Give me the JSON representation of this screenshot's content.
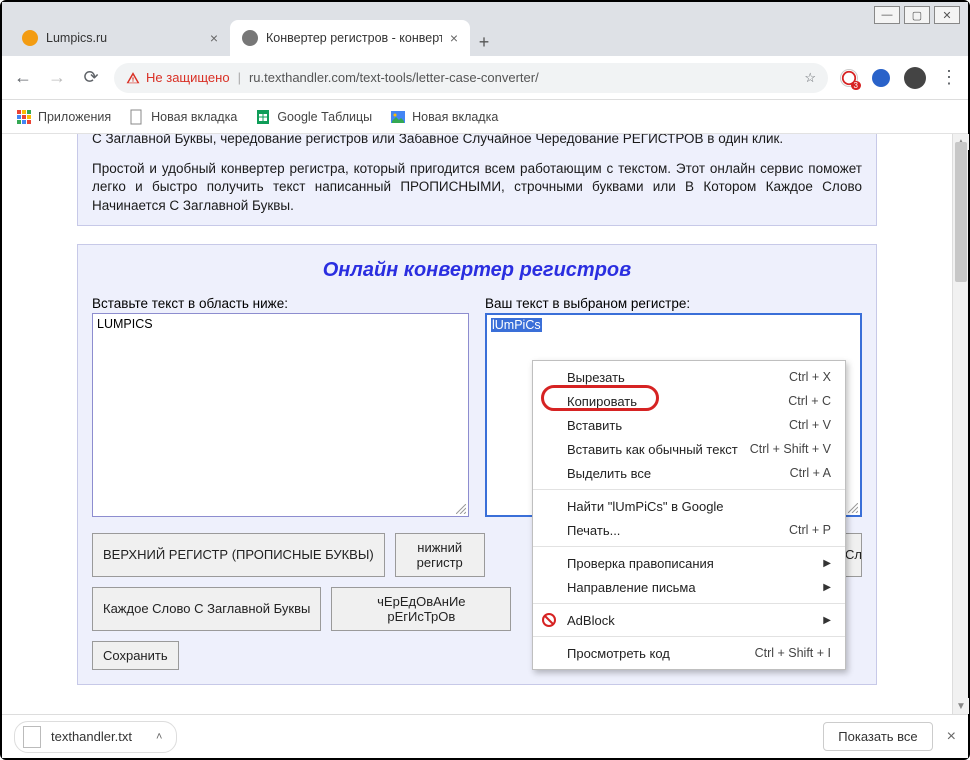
{
  "window": {
    "min": "—",
    "max": "▢",
    "close": "✕"
  },
  "tabs": [
    {
      "title": "Lumpics.ru",
      "active": false,
      "favicon": "#f39c12"
    },
    {
      "title": "Конвертер регистров - конверт",
      "active": true,
      "favicon": "#888"
    }
  ],
  "addressbar": {
    "secure_label": "Не защищено",
    "url": "ru.texthandler.com/text-tools/letter-case-converter/"
  },
  "bookmarks": [
    {
      "label": "Приложения",
      "icon": "apps"
    },
    {
      "label": "Новая вкладка",
      "icon": "page"
    },
    {
      "label": "Google Таблицы",
      "icon": "sheets"
    },
    {
      "label": "Новая вкладка",
      "icon": "image"
    }
  ],
  "page": {
    "desc_line_cut": "С Заглавной Буквы, чередование регистров или Забавное Случайное Чередование РЕГИСТРОВ в один клик.",
    "desc_para": "Простой и удобный конвертер регистра, который пригодится всем работающим с текстом. Этот онлайн сервис поможет легко и быстро получить текст написанный ПРОПИСНЫМИ, строчными буквами или В Котором Каждое Слово Начинается С Заглавной Буквы.",
    "conv_title": "Онлайн конвертер регистров",
    "input_label": "Вставьте текст в область ниже:",
    "output_label": "Ваш текст в выбраном регистре:",
    "input_text": "LUMPICS",
    "output_text": "lUmPiCs",
    "buttons": {
      "upper": "ВЕРХНИЙ РЕГИСТР (ПРОПИСНЫЕ БУКВЫ)",
      "lower": "нижний регистр",
      "capwords": "Каждое Слово С Заглавной Буквы",
      "alt": "чЕрЕдОвАнИе рЕгИсТрОв",
      "random": "Случайный",
      "save": "Сохранить"
    }
  },
  "context_menu": {
    "cut": {
      "label": "Вырезать",
      "shortcut": "Ctrl + X"
    },
    "copy": {
      "label": "Копировать",
      "shortcut": "Ctrl + C"
    },
    "paste": {
      "label": "Вставить",
      "shortcut": "Ctrl + V"
    },
    "paste_plain": {
      "label": "Вставить как обычный текст",
      "shortcut": "Ctrl + Shift + V"
    },
    "select_all": {
      "label": "Выделить все",
      "shortcut": "Ctrl + A"
    },
    "search": {
      "label": "Найти \"lUmPiCs\" в Google"
    },
    "print": {
      "label": "Печать...",
      "shortcut": "Ctrl + P"
    },
    "spellcheck": {
      "label": "Проверка правописания"
    },
    "direction": {
      "label": "Направление письма"
    },
    "adblock": {
      "label": "AdBlock"
    },
    "inspect": {
      "label": "Просмотреть код",
      "shortcut": "Ctrl + Shift + I"
    }
  },
  "downloads": {
    "file": "texthandler.txt",
    "show_all": "Показать все"
  }
}
